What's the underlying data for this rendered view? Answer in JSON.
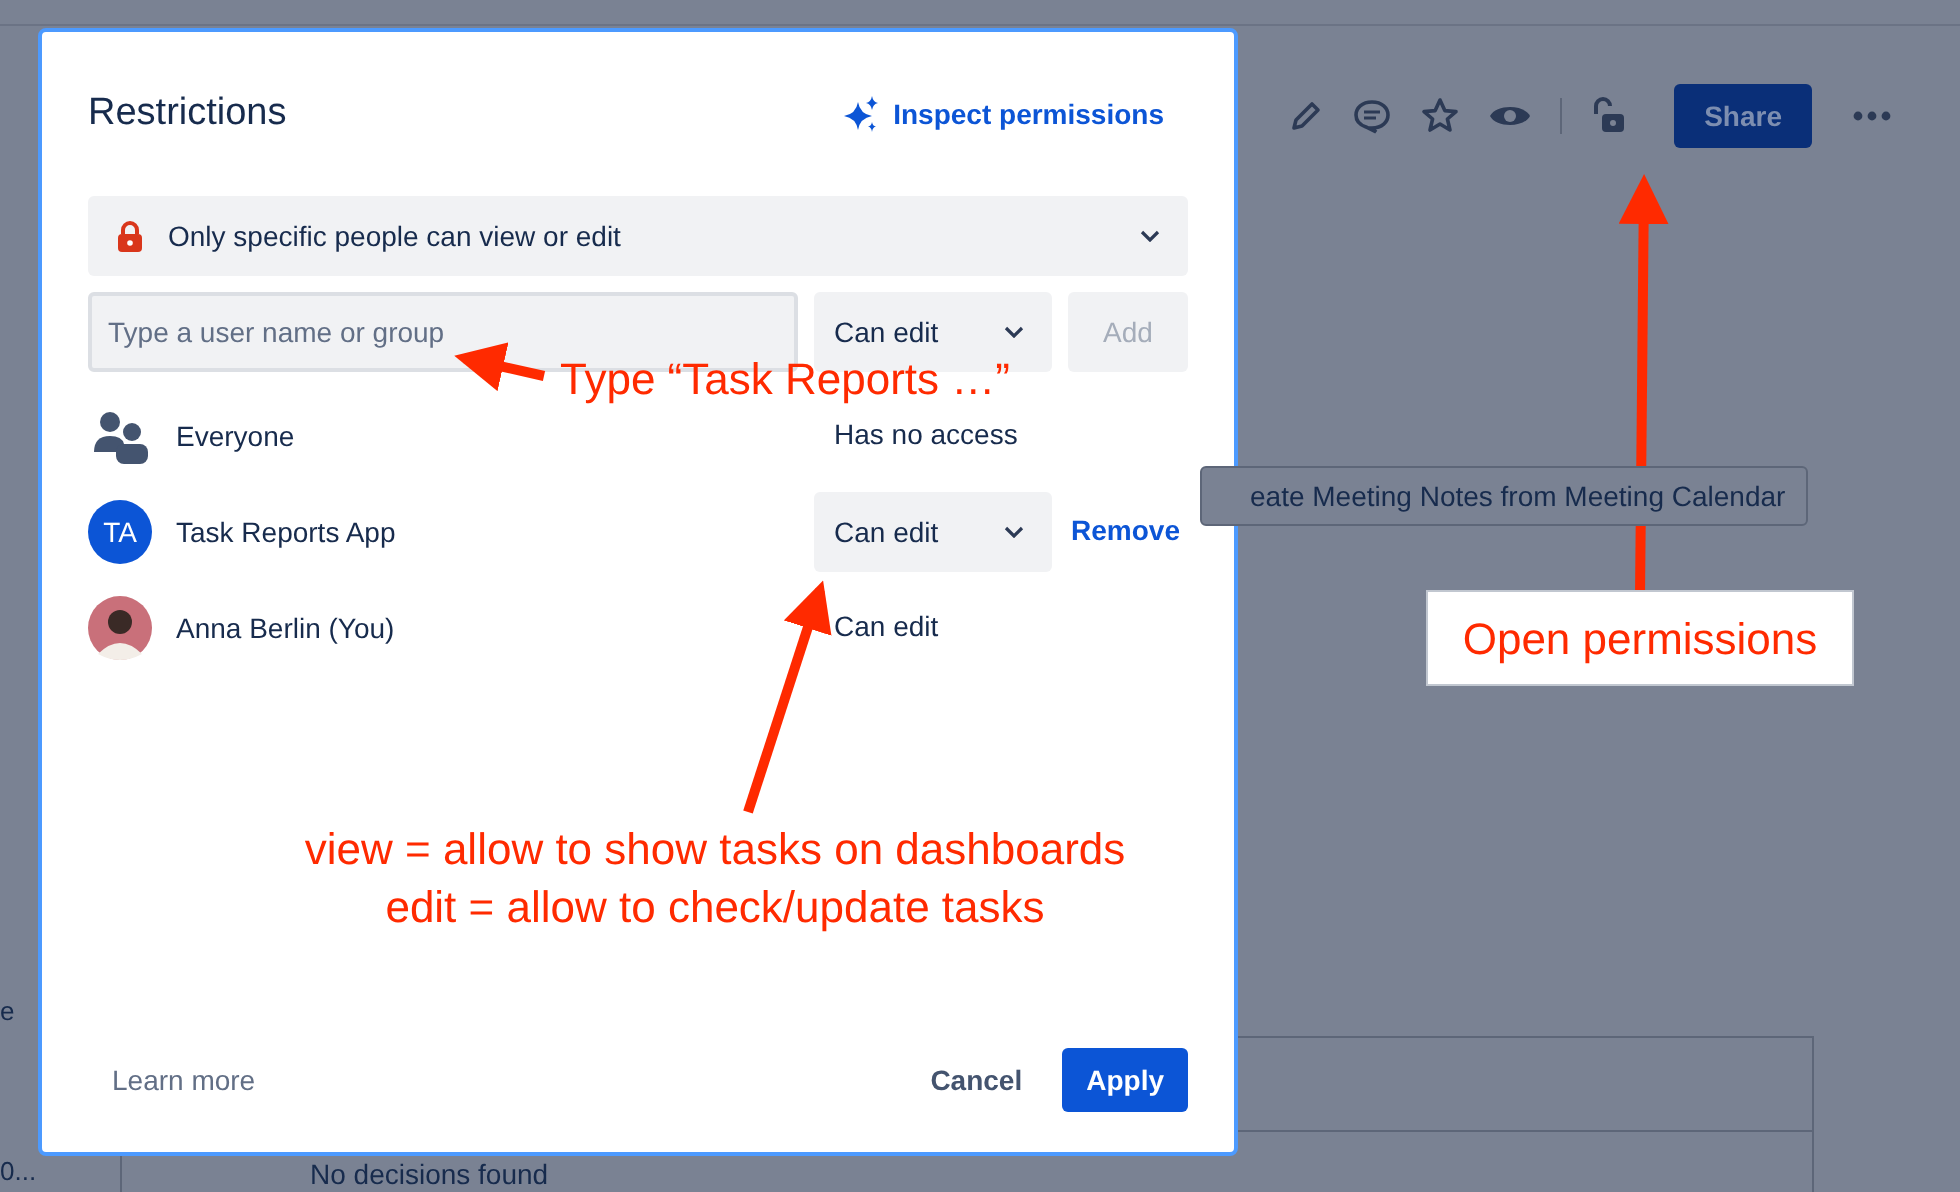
{
  "page": {
    "share_button": "Share",
    "macro_button": "eate Meeting Notes from Meeting Calendar",
    "table_cell": "No decisions found",
    "left_fragments": [
      "e",
      "0..."
    ]
  },
  "dialog": {
    "title": "Restrictions",
    "inspect_link": "Inspect permissions",
    "restriction_select": "Only specific people can view or edit",
    "search": {
      "placeholder": "Type a user name or group"
    },
    "role_select": "Can edit",
    "add_button": {
      "label": "Add",
      "disabled": true
    },
    "entries": [
      {
        "kind": "group",
        "name": "Everyone",
        "access": "Has no access",
        "editable": false
      },
      {
        "kind": "app",
        "initials": "TA",
        "name": "Task Reports App",
        "access": "Can edit",
        "editable": true,
        "remove_label": "Remove"
      },
      {
        "kind": "user",
        "name": "Anna Berlin (You)",
        "access": "Can edit",
        "editable": false
      }
    ],
    "learn_more": "Learn more",
    "cancel": "Cancel",
    "apply": "Apply"
  },
  "annotations": [
    {
      "boxed": false,
      "lines": [
        "Type “Task Reports …”"
      ]
    },
    {
      "boxed": false,
      "lines": [
        "view = allow to show tasks on dashboards",
        "edit = allow to check/update tasks"
      ]
    },
    {
      "boxed": true,
      "lines": [
        "Open permissions"
      ]
    }
  ]
}
